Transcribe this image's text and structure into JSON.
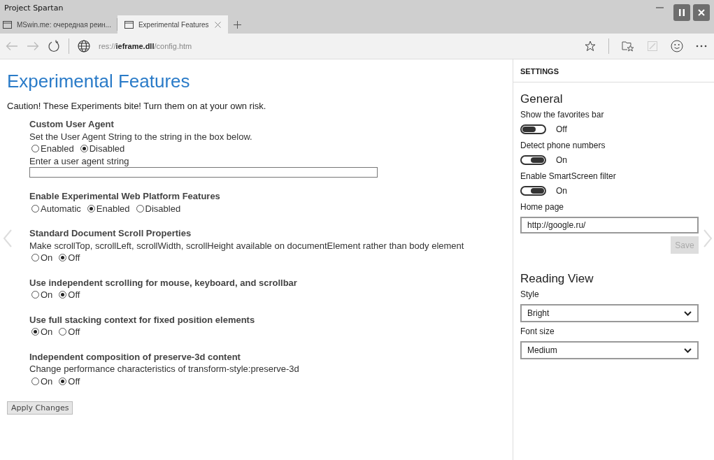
{
  "window": {
    "title": "Project Spartan"
  },
  "tabs": [
    {
      "label": "MSwin.me: очередная реин...",
      "selected": false
    },
    {
      "label": "Experimental Features",
      "selected": true
    }
  ],
  "address": "res://**ieframe.dll**/config.htm",
  "page": {
    "title": "Experimental Features",
    "caution": "Caution! These Experiments bite! Turn them on at your own risk.",
    "features": [
      {
        "title": "Custom User Agent",
        "description": "Set the User Agent String to the string in the box below.",
        "options": [
          {
            "label": "Enabled",
            "selected": false
          },
          {
            "label": "Disabled",
            "selected": true
          }
        ],
        "field_label": "Enter a user agent string"
      },
      {
        "title": "Enable Experimental Web Platform Features",
        "options": [
          {
            "label": "Automatic",
            "selected": false
          },
          {
            "label": "Enabled",
            "selected": true
          },
          {
            "label": "Disabled",
            "selected": false
          }
        ]
      },
      {
        "title": "Standard Document Scroll Properties",
        "description": "Make scrollTop, scrollLeft, scrollWidth, scrollHeight available on documentElement rather than body element",
        "options": [
          {
            "label": "On",
            "selected": false
          },
          {
            "label": "Off",
            "selected": true
          }
        ]
      },
      {
        "title": "Use independent scrolling for mouse, keyboard, and scrollbar",
        "options": [
          {
            "label": "On",
            "selected": false
          },
          {
            "label": "Off",
            "selected": true
          }
        ]
      },
      {
        "title": "Use full stacking context for fixed position elements",
        "options": [
          {
            "label": "On",
            "selected": true
          },
          {
            "label": "Off",
            "selected": false
          }
        ]
      },
      {
        "title": "Independent composition of preserve-3d content",
        "description": "Change performance characteristics of transform-style:preserve-3d",
        "options": [
          {
            "label": "On",
            "selected": false
          },
          {
            "label": "Off",
            "selected": true
          }
        ]
      }
    ],
    "apply_button": "Apply Changes"
  },
  "settings": {
    "header": "SETTINGS",
    "general": {
      "heading": "General",
      "toggles": [
        {
          "label": "Show the favorites bar",
          "on": false,
          "state_text": "Off"
        },
        {
          "label": "Detect phone numbers",
          "on": true,
          "state_text": "On"
        },
        {
          "label": "Enable SmartScreen filter",
          "on": true,
          "state_text": "On"
        }
      ],
      "home_page": {
        "label": "Home page",
        "value": "http://google.ru/"
      },
      "save_button": {
        "label": "Save",
        "disabled": true
      }
    },
    "reading_view": {
      "heading": "Reading View",
      "dropdowns": [
        {
          "label": "Style",
          "value": "Bright"
        },
        {
          "label": "Font size",
          "value": "Medium"
        }
      ]
    }
  }
}
